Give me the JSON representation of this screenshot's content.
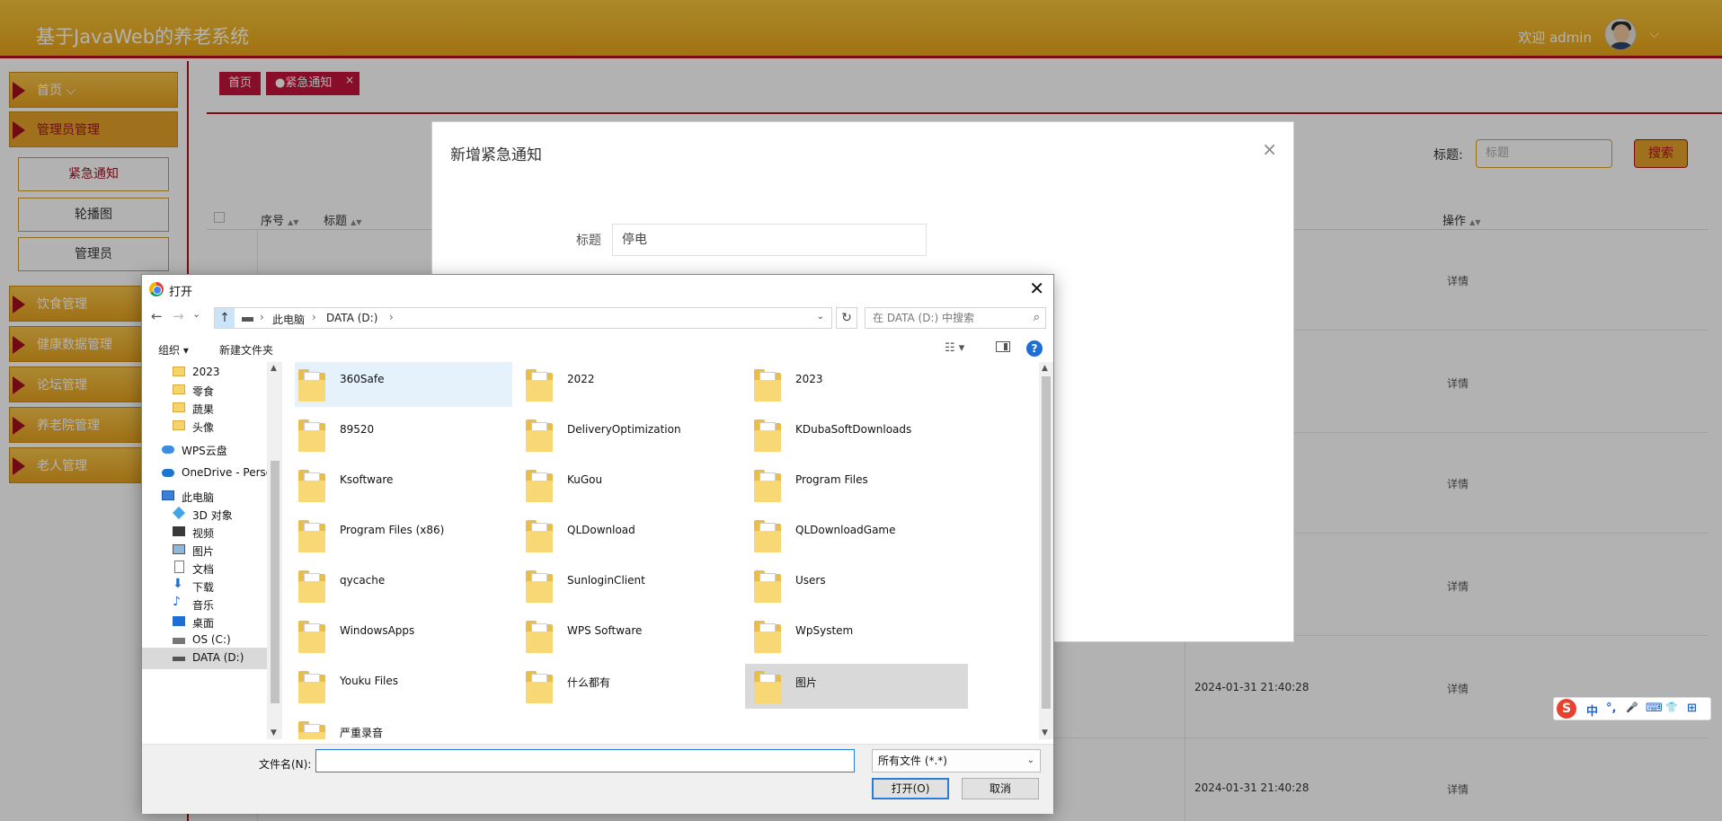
{
  "app": {
    "title": "基于JavaWeb的养老系统",
    "welcome": "欢迎 admin",
    "caret": "⌵"
  },
  "sidebar": {
    "items": [
      {
        "label": "首页"
      },
      {
        "label": "管理员管理"
      },
      {
        "label": "饮食管理"
      },
      {
        "label": "健康数据管理"
      },
      {
        "label": "论坛管理"
      },
      {
        "label": "养老院管理"
      },
      {
        "label": "老人管理"
      }
    ],
    "home_caret": "⌵",
    "sub_items": [
      {
        "label": "紧急通知"
      },
      {
        "label": "轮播图"
      },
      {
        "label": "管理员"
      }
    ]
  },
  "tabs": [
    {
      "label": "首页"
    },
    {
      "label": "●紧急通知"
    }
  ],
  "tab_close": "×",
  "search": {
    "label": "标题:",
    "placeholder": "标题",
    "button": "搜索"
  },
  "table": {
    "headers": [
      "序号",
      "标题",
      "操作"
    ],
    "sort_glyph": "▲▼",
    "rows": [
      {
        "time": "",
        "op": "详情"
      },
      {
        "time": "",
        "op": "详情"
      },
      {
        "time": "",
        "op": "详情"
      },
      {
        "time": "",
        "op": "详情"
      },
      {
        "time": "2024-01-31 21:40:28",
        "op": "详情"
      },
      {
        "time": "2024-01-31 21:40:28",
        "op": "详情"
      }
    ]
  },
  "modal": {
    "title": "新增紧急通知",
    "close": "×",
    "field_label": "标题",
    "field_value": "停电"
  },
  "dialog": {
    "title": "打开",
    "close": "✕",
    "nav": {
      "back": "←",
      "forward": "→",
      "recent": "⌄",
      "up": "↑"
    },
    "path": [
      "此电脑",
      "DATA (D:)"
    ],
    "path_sep": "›",
    "dropdown": "⌄",
    "refresh": "↻",
    "search_placeholder": "在 DATA (D:) 中搜索",
    "search_glyph": "⌕",
    "organize": "组织 ▾",
    "new_folder": "新建文件夹",
    "view_glyph": "☷ ▾",
    "help": "?",
    "nav_pane": [
      {
        "label": "2023",
        "icon": "folder-icon"
      },
      {
        "label": "零食",
        "icon": "folder-icon"
      },
      {
        "label": "蔬果",
        "icon": "folder-icon"
      },
      {
        "label": "头像",
        "icon": "folder-icon"
      },
      {
        "label": "WPS云盘",
        "icon": "cloud-icon"
      },
      {
        "label": "OneDrive - Perso",
        "icon": "onedrive-icon"
      },
      {
        "label": "此电脑",
        "icon": "computer-icon"
      },
      {
        "label": "3D 对象",
        "icon": "cube-icon"
      },
      {
        "label": "视频",
        "icon": "video-icon"
      },
      {
        "label": "图片",
        "icon": "picture-icon"
      },
      {
        "label": "文档",
        "icon": "document-icon"
      },
      {
        "label": "下载",
        "icon": "download-icon"
      },
      {
        "label": "音乐",
        "icon": "music-icon"
      },
      {
        "label": "桌面",
        "icon": "desktop-icon"
      },
      {
        "label": "OS (C:)",
        "icon": "os-drive-icon"
      },
      {
        "label": "DATA (D:)",
        "icon": "drive-icon"
      }
    ],
    "glyphs": {
      "down_arrow": "⬇",
      "note": "♪"
    },
    "files": [
      {
        "name": "360Safe"
      },
      {
        "name": "2022"
      },
      {
        "name": "2023"
      },
      {
        "name": "89520"
      },
      {
        "name": "DeliveryOptimization"
      },
      {
        "name": "KDubaSoftDownloads"
      },
      {
        "name": "Ksoftware"
      },
      {
        "name": "KuGou"
      },
      {
        "name": "Program Files"
      },
      {
        "name": "Program Files (x86)"
      },
      {
        "name": "QLDownload"
      },
      {
        "name": "QLDownloadGame"
      },
      {
        "name": "qycache"
      },
      {
        "name": "SunloginClient"
      },
      {
        "name": "Users"
      },
      {
        "name": "WindowsApps"
      },
      {
        "name": "WPS Software"
      },
      {
        "name": "WpSystem"
      },
      {
        "name": "Youku Files"
      },
      {
        "name": "什么都有"
      },
      {
        "name": "图片"
      },
      {
        "name": "严重录音"
      }
    ],
    "scroll_up": "▲",
    "scroll_down": "▼",
    "filename_label": "文件名(N):",
    "filename_value": "",
    "filetype": "所有文件 (*.*)",
    "open_button": "打开(O)",
    "cancel_button": "取消"
  },
  "ime": {
    "logo": "S",
    "items": [
      "中",
      "°,",
      "🎤",
      "⌨",
      "👕",
      "⊞"
    ]
  }
}
